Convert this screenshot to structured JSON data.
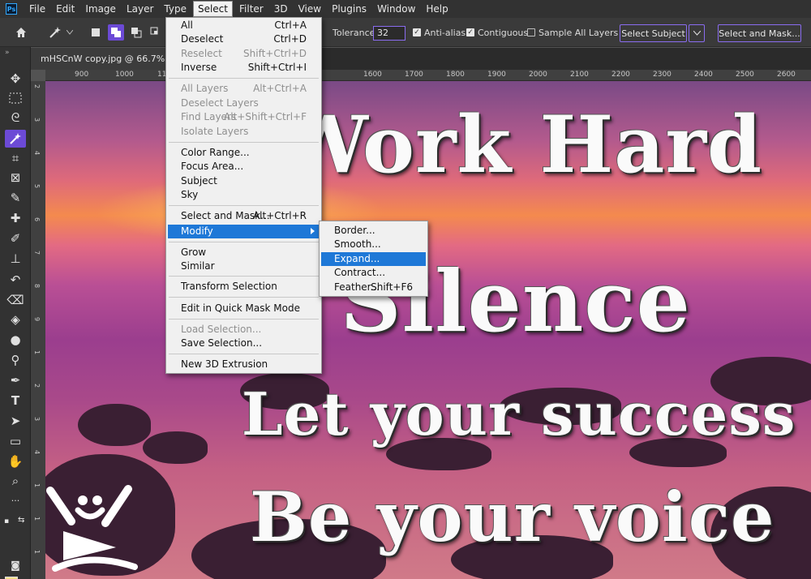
{
  "app": {
    "logo": "Ps"
  },
  "menubar": [
    "File",
    "Edit",
    "Image",
    "Layer",
    "Type",
    "Select",
    "Filter",
    "3D",
    "View",
    "Plugins",
    "Window",
    "Help"
  ],
  "options": {
    "tolerance_label": "Tolerance:",
    "tolerance_value": "32",
    "anti_alias_label": "Anti-alias",
    "contiguous_label": "Contiguous",
    "sample_all_layers_label": "Sample All Layers",
    "select_subject_label": "Select Subject",
    "select_and_mask_label": "Select and Mask..."
  },
  "document": {
    "tab_title": "mHSCnW copy.jpg @ 66.7% (RGB/8)"
  },
  "ruler": {
    "horizontal": [
      "900",
      "1000",
      "1100",
      "1600",
      "1700",
      "1800",
      "1900",
      "2000",
      "2100",
      "2200",
      "2300",
      "2400",
      "2500",
      "2600"
    ],
    "vertical": [
      "2",
      "3",
      "4",
      "5",
      "6",
      "7",
      "8",
      "9",
      "1",
      "2",
      "3",
      "4",
      "1",
      "1",
      "1"
    ]
  },
  "select_menu": {
    "items": [
      {
        "label": "All",
        "shortcut": "Ctrl+A"
      },
      {
        "label": "Deselect",
        "shortcut": "Ctrl+D"
      },
      {
        "label": "Reselect",
        "shortcut": "Shift+Ctrl+D"
      },
      {
        "label": "Inverse",
        "shortcut": "Shift+Ctrl+I"
      },
      {
        "label": "All Layers",
        "shortcut": "Alt+Ctrl+A"
      },
      {
        "label": "Deselect Layers",
        "shortcut": ""
      },
      {
        "label": "Find Layers",
        "shortcut": "Alt+Shift+Ctrl+F"
      },
      {
        "label": "Isolate Layers",
        "shortcut": ""
      },
      {
        "label": "Color Range...",
        "shortcut": ""
      },
      {
        "label": "Focus Area...",
        "shortcut": ""
      },
      {
        "label": "Subject",
        "shortcut": ""
      },
      {
        "label": "Sky",
        "shortcut": ""
      },
      {
        "label": "Select and Mask...",
        "shortcut": "Alt+Ctrl+R"
      },
      {
        "label": "Modify",
        "shortcut": ""
      },
      {
        "label": "Grow",
        "shortcut": ""
      },
      {
        "label": "Similar",
        "shortcut": ""
      },
      {
        "label": "Transform Selection",
        "shortcut": ""
      },
      {
        "label": "Edit in Quick Mask Mode",
        "shortcut": ""
      },
      {
        "label": "Load Selection...",
        "shortcut": ""
      },
      {
        "label": "Save Selection...",
        "shortcut": ""
      },
      {
        "label": "New 3D Extrusion",
        "shortcut": ""
      }
    ]
  },
  "modify_submenu": {
    "items": [
      {
        "label": "Border...",
        "shortcut": ""
      },
      {
        "label": "Smooth...",
        "shortcut": ""
      },
      {
        "label": "Expand...",
        "shortcut": ""
      },
      {
        "label": "Contract...",
        "shortcut": ""
      },
      {
        "label": "Feather...",
        "shortcut": "Shift+F6"
      }
    ]
  },
  "canvas_text": {
    "line1": "Work Hard",
    "line2": "In Silence",
    "line3": "Let your success",
    "line4": "Be your voice"
  },
  "colors": {
    "accent": "#6c4ad6",
    "highlight": "#1e78d7",
    "foreground_swatch": "#f3e08c",
    "background_swatch": "#000000"
  }
}
